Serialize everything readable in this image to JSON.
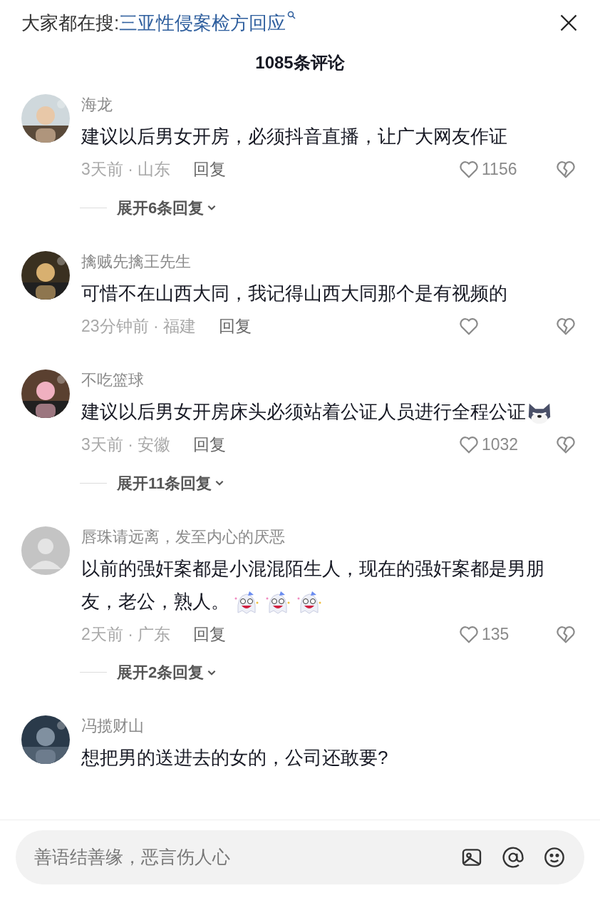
{
  "search_bar": {
    "label": "大家都在搜:",
    "query": "三亚性侵案检方回应"
  },
  "title": "1085条评论",
  "comments": [
    {
      "name": "海龙",
      "text": "建议以后男女开房，必须抖音直播，让广大网友作证",
      "meta": "3天前 · 山东",
      "reply": "回复",
      "likes": "1156",
      "expand": "展开6条回复"
    },
    {
      "name": "擒贼先擒王先生",
      "text": "可惜不在山西大同，我记得山西大同那个是有视频的",
      "meta": "23分钟前 · 福建",
      "reply": "回复"
    },
    {
      "name": "不吃篮球",
      "text": "建议以后男女开房床头必须站着公证人员进行全程公证",
      "emojis": [
        {
          "kind": "wolf"
        }
      ],
      "meta": "3天前 · 安徽",
      "reply": "回复",
      "likes": "1032",
      "expand": "展开11条回复"
    },
    {
      "avatar": {
        "kind": "default"
      },
      "name": "唇珠请远离，发至内心的厌恶",
      "text": "以前的强奸案都是小混混陌生人，现在的强奸案都是男朋友，老公，熟人。",
      "emojis": [
        {
          "kind": "ghost"
        },
        {
          "kind": "ghost"
        },
        {
          "kind": "ghost"
        }
      ],
      "meta": "2天前 · 广东",
      "reply": "回复",
      "likes": "135",
      "expand": "展开2条回复"
    },
    {
      "name": "冯揽财山",
      "text": "想把男的送进去的女的，公司还敢要?"
    }
  ],
  "input": {
    "placeholder": "善语结善缘，恶言伤人心"
  }
}
